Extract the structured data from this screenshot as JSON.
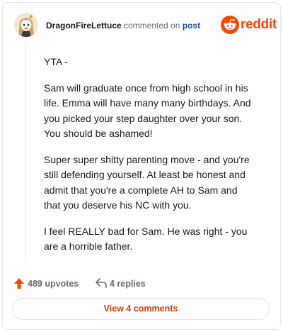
{
  "header": {
    "username": "DragonFireLettuce",
    "action_text": "commented on",
    "post_link": "post",
    "brand_wordmark": "reddit"
  },
  "comment": {
    "paragraphs": [
      "YTA -",
      "Sam will graduate once from high school in his life. Emma will have many many birthdays. And you picked your step daughter over your son. You should be ashamed!",
      "Super super shitty parenting move - and you're still defending yourself. At least be honest and admit that you're a complete AH to Sam and that you deserve his NC with you.",
      "I feel REALLY bad for Sam. He was right - you are a horrible father."
    ]
  },
  "stats": {
    "upvotes_label": "489 upvotes",
    "replies_label": "4 replies",
    "upvote_icon": "arrow-up-icon",
    "reply_icon": "reply-arrow-icon"
  },
  "footer": {
    "view_comments_label": "View 4 comments"
  },
  "colors": {
    "brand": "#ff4500",
    "upvote": "#ff4500",
    "view_button_text": "#d93a00",
    "post_link": "#1a4a9c",
    "muted_text": "#5f6b76"
  }
}
